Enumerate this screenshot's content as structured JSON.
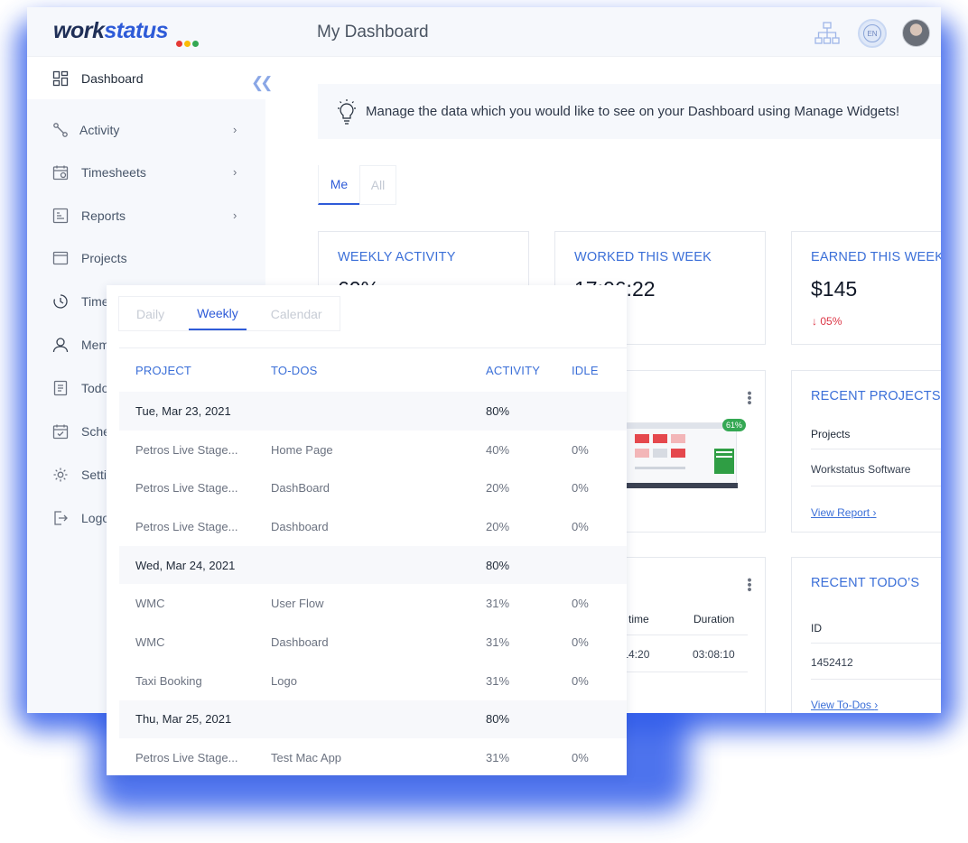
{
  "brand": {
    "logo_part1": "work",
    "logo_part2": "status",
    "dot_colors": [
      "#e53935",
      "#fbbc05",
      "#34a853"
    ]
  },
  "header": {
    "title": "My Dashboard",
    "lang_label": "EN"
  },
  "sidebar": {
    "items": [
      {
        "label": "Dashboard",
        "icon": "dashboard-grid-icon",
        "active": true
      },
      {
        "label": "Activity",
        "icon": "activity-icon",
        "chevron": true
      },
      {
        "label": "Timesheets",
        "icon": "calendar-clock-icon",
        "chevron": true
      },
      {
        "label": "Reports",
        "icon": "report-icon",
        "chevron": true
      },
      {
        "label": "Projects",
        "icon": "folder-icon"
      },
      {
        "label": "Time",
        "icon": "timer-icon"
      },
      {
        "label": "Mem",
        "icon": "member-icon"
      },
      {
        "label": "Todo",
        "icon": "todo-icon"
      },
      {
        "label": "Sche",
        "icon": "schedule-icon"
      },
      {
        "label": "Setti",
        "icon": "settings-icon"
      },
      {
        "label": "Logo",
        "icon": "logout-icon"
      }
    ]
  },
  "tip": {
    "text": "Manage the data which you would like to see on your Dashboard using Manage Widgets!"
  },
  "scope_tabs": {
    "me": "Me",
    "all": "All"
  },
  "cards": {
    "weekly_activity": {
      "title": "WEEKLY ACTIVITY",
      "value": "60%"
    },
    "worked": {
      "title": "WORKED THIS WEEK",
      "value": "17:06:22"
    },
    "earned": {
      "title": "EARNED THIS WEEK",
      "value": "$145",
      "delta": "05%"
    },
    "screenshot_badge": "61%",
    "timeline": {
      "col_stop": "p time",
      "col_duration": "Duration",
      "stop_value": ":14:20",
      "duration_value": "03:08:10"
    },
    "recent_projects": {
      "title": "RECENT PROJECTS",
      "col": "Projects",
      "row": "Workstatus Software",
      "link": "View Report"
    },
    "recent_todos": {
      "title": "RECENT TODO’S",
      "col": "ID",
      "row": "1452412",
      "link": "View To-Dos"
    }
  },
  "popup": {
    "tabs": [
      "Daily",
      "Weekly",
      "Calendar"
    ],
    "active_tab": "Weekly",
    "columns": [
      "PROJECT",
      "TO-DOS",
      "ACTIVITY",
      "IDLE"
    ],
    "rows": [
      {
        "type": "day",
        "project": "Tue, Mar 23, 2021",
        "todo": "",
        "activity": "80%",
        "idle": ""
      },
      {
        "type": "item",
        "project": "Petros Live Stage...",
        "todo": "Home Page",
        "activity": "40%",
        "idle": "0%"
      },
      {
        "type": "item",
        "project": "Petros Live Stage...",
        "todo": "DashBoard",
        "activity": "20%",
        "idle": "0%"
      },
      {
        "type": "item",
        "project": "Petros Live Stage...",
        "todo": "Dashboard",
        "activity": "20%",
        "idle": "0%"
      },
      {
        "type": "day",
        "project": "Wed, Mar 24, 2021",
        "todo": "",
        "activity": "80%",
        "idle": ""
      },
      {
        "type": "item",
        "project": "WMC",
        "todo": "User Flow",
        "activity": "31%",
        "idle": "0%"
      },
      {
        "type": "item",
        "project": "WMC",
        "todo": "Dashboard",
        "activity": "31%",
        "idle": "0%"
      },
      {
        "type": "item",
        "project": "Taxi Booking",
        "todo": "Logo",
        "activity": "31%",
        "idle": "0%"
      },
      {
        "type": "day",
        "project": "Thu, Mar 25, 2021",
        "todo": "",
        "activity": "80%",
        "idle": ""
      },
      {
        "type": "item",
        "project": "Petros Live Stage...",
        "todo": "Test Mac App",
        "activity": "31%",
        "idle": "0%"
      }
    ]
  }
}
